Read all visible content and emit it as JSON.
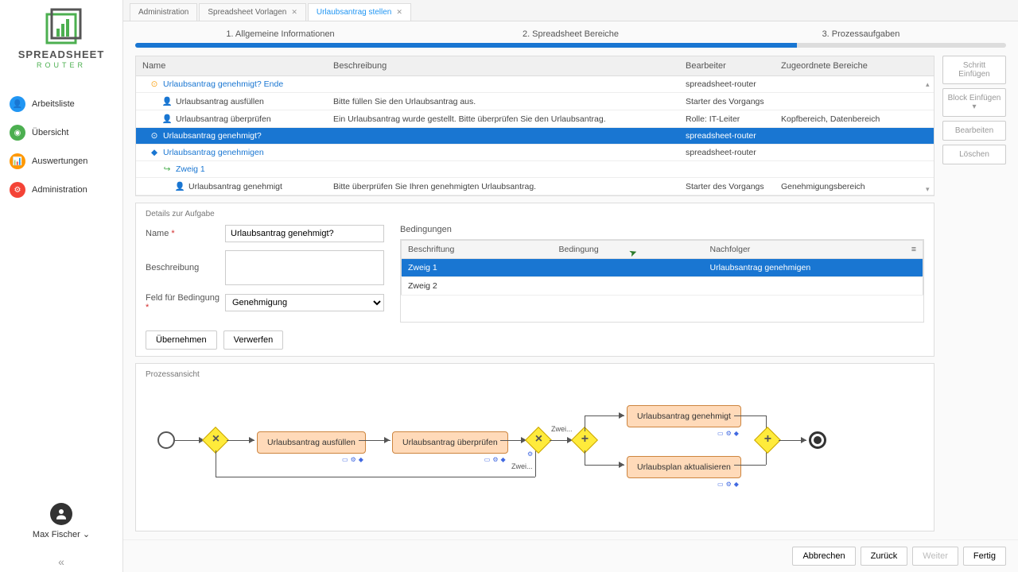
{
  "app": {
    "name": "SPREADSHEET",
    "subtitle": "ROUTER"
  },
  "nav": [
    {
      "label": "Arbeitsliste",
      "color": "blue",
      "glyph": "👤"
    },
    {
      "label": "Übersicht",
      "color": "green",
      "glyph": "◉"
    },
    {
      "label": "Auswertungen",
      "color": "orange",
      "glyph": "📊"
    },
    {
      "label": "Administration",
      "color": "red",
      "glyph": "⚙"
    }
  ],
  "user": {
    "name": "Max Fischer"
  },
  "tabs": [
    {
      "label": "Administration",
      "active": false,
      "closable": false
    },
    {
      "label": "Spreadsheet Vorlagen",
      "active": false,
      "closable": true
    },
    {
      "label": "Urlaubsantrag stellen",
      "active": true,
      "closable": true
    }
  ],
  "wizard": {
    "steps": [
      "1. Allgemeine Informationen",
      "2. Spreadsheet Bereiche",
      "3. Prozessaufgaben"
    ]
  },
  "taskTable": {
    "headers": {
      "name": "Name",
      "desc": "Beschreibung",
      "editor": "Bearbeiter",
      "areas": "Zugeordnete Bereiche"
    },
    "rows": [
      {
        "indent": 1,
        "icon": "⊙",
        "iconColor": "#F9A825",
        "name": "Urlaubsantrag genehmigt? Ende",
        "desc": "",
        "editor": "spreadsheet-router",
        "areas": "",
        "sel": false,
        "linkish": true
      },
      {
        "indent": 2,
        "icon": "👤",
        "name": "Urlaubsantrag ausfüllen",
        "desc": "Bitte füllen Sie den Urlaubsantrag aus.",
        "editor": "Starter des Vorgangs",
        "areas": "",
        "sel": false
      },
      {
        "indent": 2,
        "icon": "👤",
        "name": "Urlaubsantrag überprüfen",
        "desc": "Ein Urlaubsantrag wurde gestellt. Bitte überprüfen Sie den Urlaubsantrag.",
        "editor": "Rolle: IT-Leiter",
        "areas": "Kopfbereich, Datenbereich",
        "sel": false
      },
      {
        "indent": 1,
        "icon": "⊙",
        "name": "Urlaubsantrag genehmigt?",
        "desc": "",
        "editor": "spreadsheet-router",
        "areas": "",
        "sel": true
      },
      {
        "indent": 1,
        "icon": "◆",
        "iconColor": "#1976D2",
        "name": "Urlaubsantrag genehmigen",
        "desc": "",
        "editor": "spreadsheet-router",
        "areas": "",
        "sel": false,
        "linkish": true
      },
      {
        "indent": 2,
        "icon": "↪",
        "iconColor": "#4CAF50",
        "name": "Zweig 1",
        "desc": "",
        "editor": "",
        "areas": "",
        "sel": false,
        "linkish": true
      },
      {
        "indent": 3,
        "icon": "👤",
        "name": "Urlaubsantrag genehmigt",
        "desc": "Bitte überprüfen Sie Ihren genehmigten Urlaubsantrag.",
        "editor": "Starter des Vorgangs",
        "areas": "Genehmigungsbereich",
        "sel": false
      }
    ]
  },
  "actions": {
    "insertStep": "Schritt Einfügen",
    "insertBlock": "Block Einfügen",
    "edit": "Bearbeiten",
    "delete": "Löschen"
  },
  "details": {
    "title": "Details zur Aufgabe",
    "labels": {
      "name": "Name",
      "desc": "Beschreibung",
      "condField": "Feld für Bedingung"
    },
    "values": {
      "name": "Urlaubsantrag genehmigt?",
      "condField": "Genehmigung"
    },
    "buttons": {
      "apply": "Übernehmen",
      "discard": "Verwerfen"
    }
  },
  "conditions": {
    "title": "Bedingungen",
    "headers": {
      "label": "Beschriftung",
      "cond": "Bedingung",
      "succ": "Nachfolger"
    },
    "rows": [
      {
        "label": "Zweig 1",
        "cond": "",
        "succ": "Urlaubsantrag genehmigen",
        "sel": true
      },
      {
        "label": "Zweig 2",
        "cond": "",
        "succ": "",
        "sel": false
      }
    ]
  },
  "process": {
    "title": "Prozessansicht",
    "tasks": {
      "t1": "Urlaubsantrag ausfüllen",
      "t2": "Urlaubsantrag überprüfen",
      "t3": "Urlaubsantrag genehmigt",
      "t4": "Urlaubsplan aktualisieren"
    },
    "labels": {
      "z1": "Zwei...",
      "z2": "Zwei..."
    }
  },
  "footer": {
    "cancel": "Abbrechen",
    "back": "Zurück",
    "next": "Weiter",
    "finish": "Fertig"
  }
}
